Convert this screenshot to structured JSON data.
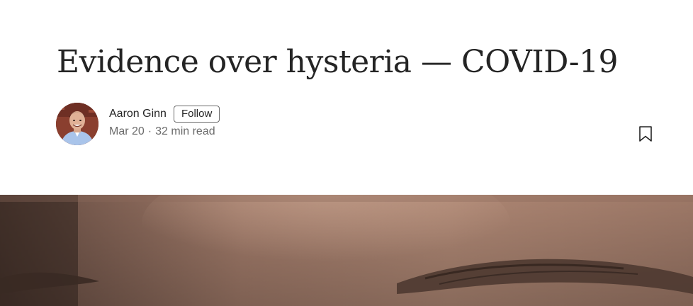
{
  "article": {
    "title": "Evidence over hysteria — COVID-19"
  },
  "author": {
    "name": "Aaron Ginn",
    "follow_label": "Follow",
    "date": "Mar 20",
    "separator": "·",
    "read_time": "32 min read"
  },
  "icons": {
    "bookmark": "bookmark-icon",
    "avatar": "author-avatar"
  },
  "colors": {
    "text_primary": "#242424",
    "text_secondary": "#6b6b6b",
    "skin_tone": "#b88a76"
  }
}
